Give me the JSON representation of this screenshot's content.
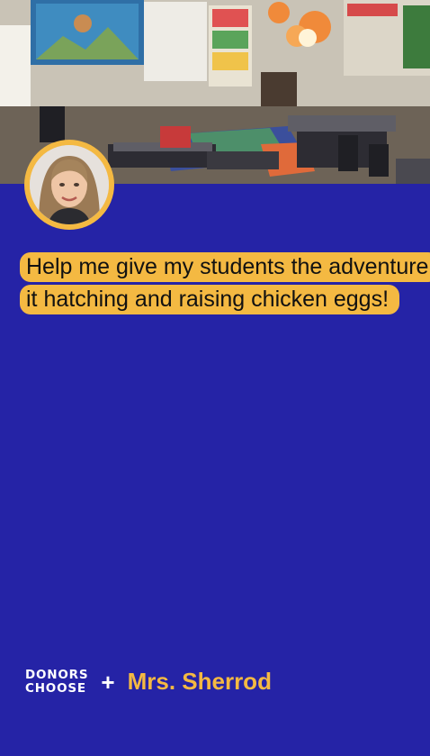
{
  "project": {
    "headline": "Help me give my students the adventure it hatching and raising chicken eggs!"
  },
  "brand": {
    "logo_line1": "DONORS",
    "logo_line2": "CHOOSE",
    "plus": "+"
  },
  "teacher": {
    "name": "Mrs. Sherrod"
  },
  "colors": {
    "background": "#2523a6",
    "accent": "#f4b942",
    "logo_text": "#ffffff"
  },
  "images": {
    "hero": "classroom-photo",
    "avatar": "teacher-portrait"
  }
}
